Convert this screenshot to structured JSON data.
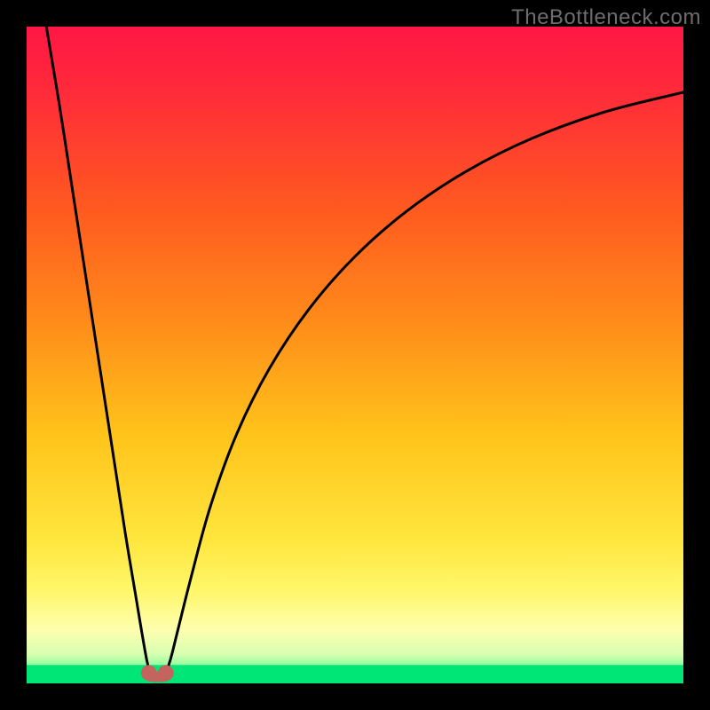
{
  "watermark": "TheBottleneck.com",
  "chart_data": {
    "type": "line",
    "title": "",
    "xlabel": "",
    "ylabel": "",
    "xlim": [
      0,
      100
    ],
    "ylim": [
      0,
      100
    ],
    "grid": false,
    "legend": false,
    "gradient_stops": [
      {
        "offset": 0.0,
        "color": "#ff1744"
      },
      {
        "offset": 0.1,
        "color": "#ff2b3a"
      },
      {
        "offset": 0.28,
        "color": "#ff5a1f"
      },
      {
        "offset": 0.45,
        "color": "#ff8c1a"
      },
      {
        "offset": 0.62,
        "color": "#ffc31a"
      },
      {
        "offset": 0.78,
        "color": "#ffe63d"
      },
      {
        "offset": 0.86,
        "color": "#fff76b"
      },
      {
        "offset": 0.92,
        "color": "#fdffb0"
      },
      {
        "offset": 0.955,
        "color": "#d8ffb0"
      },
      {
        "offset": 0.98,
        "color": "#79ff9a"
      },
      {
        "offset": 1.0,
        "color": "#00e676"
      }
    ],
    "series": [
      {
        "name": "left-branch",
        "stroke": "#000000",
        "x": [
          3,
          5,
          7,
          9,
          11,
          13,
          15,
          16.5,
          17.5,
          18.3,
          18.8
        ],
        "y": [
          100,
          88,
          75,
          62,
          49,
          36,
          23,
          14,
          8,
          3.5,
          1.5
        ]
      },
      {
        "name": "right-branch",
        "stroke": "#000000",
        "x": [
          21.2,
          22,
          23,
          25,
          28,
          32,
          37,
          43,
          50,
          58,
          67,
          77,
          88,
          100
        ],
        "y": [
          1.5,
          4,
          8,
          16,
          27,
          38,
          48,
          57,
          65,
          72,
          78,
          83,
          87,
          90
        ]
      }
    ],
    "markers": [
      {
        "name": "valley-left-dot",
        "x": 18.6,
        "y": 1.6,
        "r": 1.2,
        "color": "#c4645e"
      },
      {
        "name": "valley-right-dot",
        "x": 21.2,
        "y": 1.6,
        "r": 1.2,
        "color": "#c4645e"
      }
    ],
    "valley_band": {
      "x0": 18.6,
      "x1": 21.2,
      "y": 1.0,
      "thickness": 1.6,
      "color": "#c4645e"
    },
    "bottom_green_band": {
      "y0": 0,
      "y1": 2.8,
      "color": "#00e676"
    }
  }
}
